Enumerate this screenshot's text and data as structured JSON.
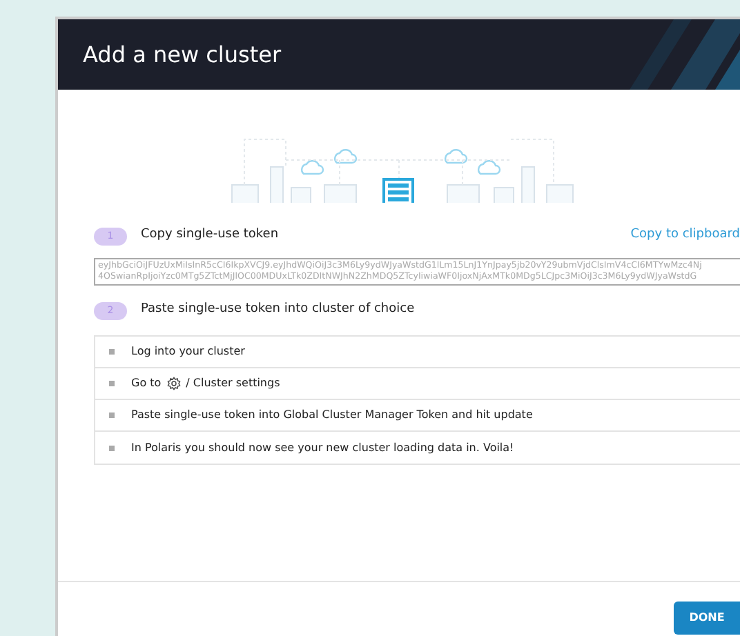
{
  "dialog": {
    "title": "Add a new cluster"
  },
  "steps": [
    {
      "number": "1",
      "label": "Copy single-use token",
      "action": "Copy to clipboard"
    },
    {
      "number": "2",
      "label": "Paste single-use token into cluster of choice"
    }
  ],
  "token": {
    "lines": [
      "eyJhbGciOiJFUzUxMiIsInR5cCI6IkpXVCJ9.eyJhdWQiOiJ3c3M6Ly9ydWJyaWstdG1lLm15LnJ1YnJpay5jb20vY29ubmVjdClsImV4cCI6MTYwMzc4Nj",
      "4OSwianRpIjoiYzc0MTg5ZTctMjJlOC00MDUxLTk0ZDItNWJhN2ZhMDQ5ZTcyIiwiaWF0IjoxNjAxMTk0MDg5LCJpc3MiOiJ3c3M6Ly9ydWJyaWstdG"
    ]
  },
  "instructions": [
    {
      "kind": "text",
      "text": "Log into your cluster"
    },
    {
      "kind": "icon",
      "before": "Go to",
      "after": "/ Cluster settings"
    },
    {
      "kind": "text",
      "text": "Paste single-use token into Global Cluster Manager Token and hit update"
    },
    {
      "kind": "text",
      "text": "In Polaris you should now see your new cluster loading data in. Voila!"
    }
  ],
  "footer": {
    "button": "DONE"
  }
}
